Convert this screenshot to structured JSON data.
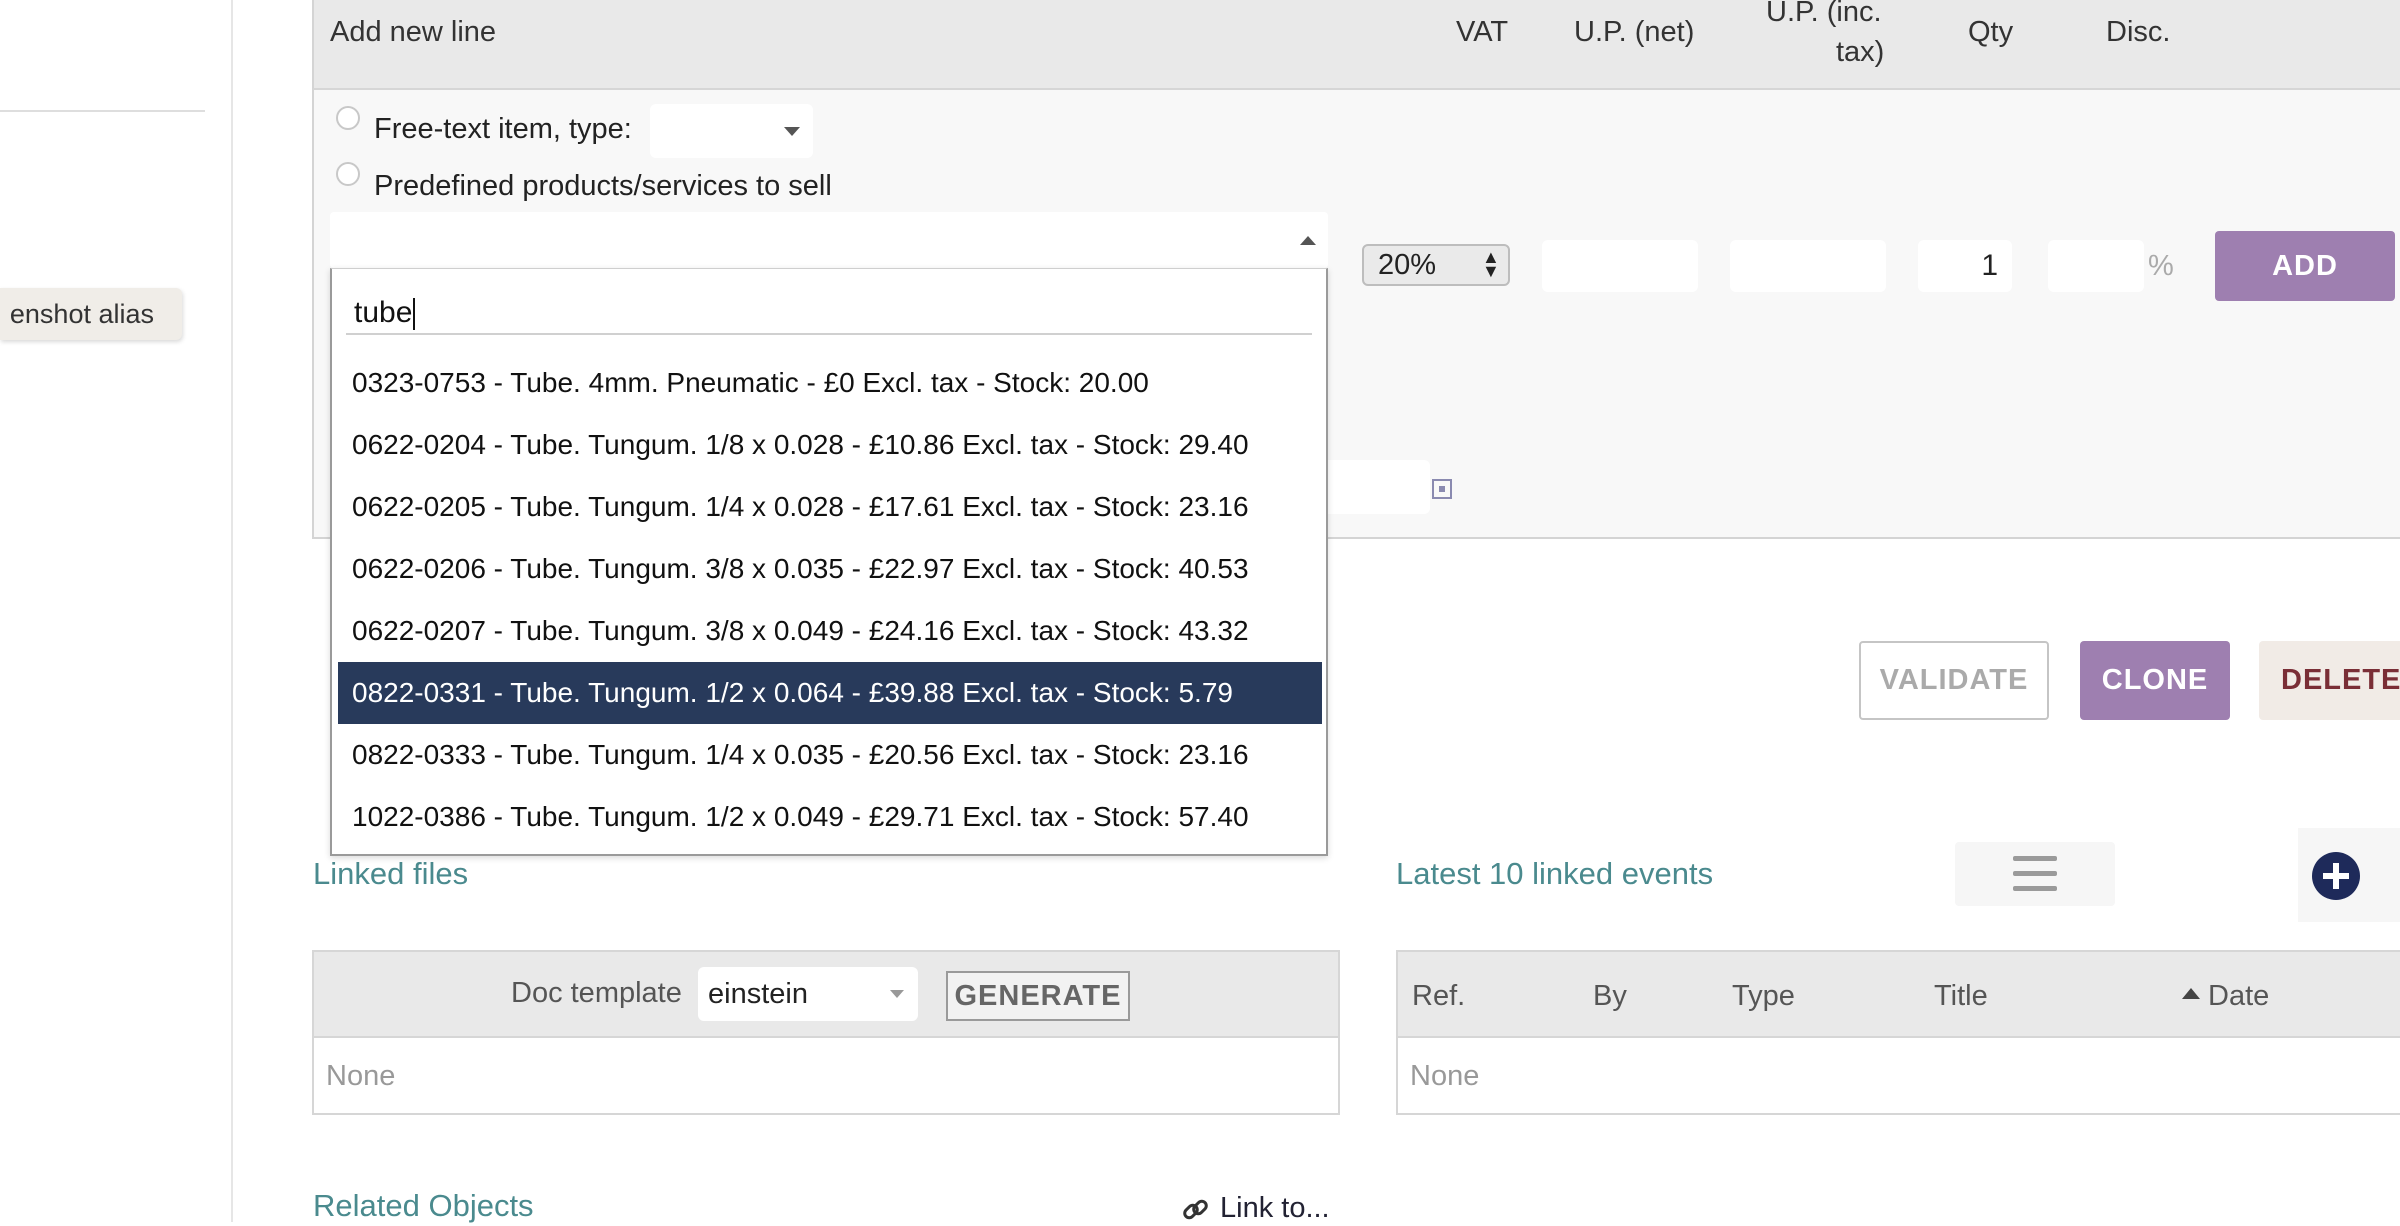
{
  "sidebar": {
    "alias_chip": "enshot alias"
  },
  "add_line": {
    "title": "Add new line",
    "columns": {
      "vat": "VAT",
      "up_net": "U.P. (net)",
      "up_inc_tax_1": "U.P. (inc.",
      "up_inc_tax_2": "tax)",
      "qty": "Qty",
      "disc": "Disc."
    },
    "free_text_label": "Free-text item, type:",
    "predefined_label": "Predefined products/services to sell",
    "vat_value": "20%",
    "up_net_value": "",
    "up_inc_tax_value": "",
    "qty_value": "1",
    "disc_value": "",
    "disc_unit": "%",
    "add_label": "ADD"
  },
  "dropdown": {
    "search_value": "tube",
    "items": [
      "0323-0753 - Tube. 4mm. Pneumatic - £0 Excl. tax - Stock: 20.00",
      "0622-0204 - Tube. Tungum. 1/8 x 0.028 - £10.86 Excl. tax - Stock: 29.40",
      "0622-0205 - Tube. Tungum. 1/4 x 0.028 - £17.61 Excl. tax - Stock: 23.16",
      "0622-0206 - Tube. Tungum. 3/8 x 0.035 - £22.97 Excl. tax - Stock: 40.53",
      "0622-0207 - Tube. Tungum. 3/8 x 0.049 - £24.16 Excl. tax - Stock: 43.32",
      "0822-0331 - Tube. Tungum. 1/2 x 0.064 - £39.88 Excl. tax - Stock: 5.79",
      "0822-0333 - Tube. Tungum. 1/4 x 0.035 - £20.56 Excl. tax - Stock: 23.16",
      "1022-0386 - Tube. Tungum. 1/2 x 0.049 - £29.71 Excl. tax - Stock: 57.40"
    ],
    "selected_index": 5
  },
  "actions": {
    "validate": "VALIDATE",
    "clone": "CLONE",
    "delete": "DELETE"
  },
  "linked_files": {
    "title": "Linked files",
    "doc_template_label": "Doc template",
    "doc_template_value": "einstein",
    "generate_label": "GENERATE",
    "empty": "None"
  },
  "events": {
    "title": "Latest 10 linked events",
    "columns": {
      "ref": "Ref.",
      "by": "By",
      "type": "Type",
      "title": "Title",
      "date": "Date"
    },
    "empty": "None"
  },
  "related": {
    "title": "Related Objects",
    "link_to": "Link to..."
  },
  "icons": [
    "chevron-down-icon",
    "chevron-up-icon",
    "calendar-icon",
    "menu-icon",
    "plus-circle-icon",
    "sort-up-icon",
    "link-icon"
  ]
}
